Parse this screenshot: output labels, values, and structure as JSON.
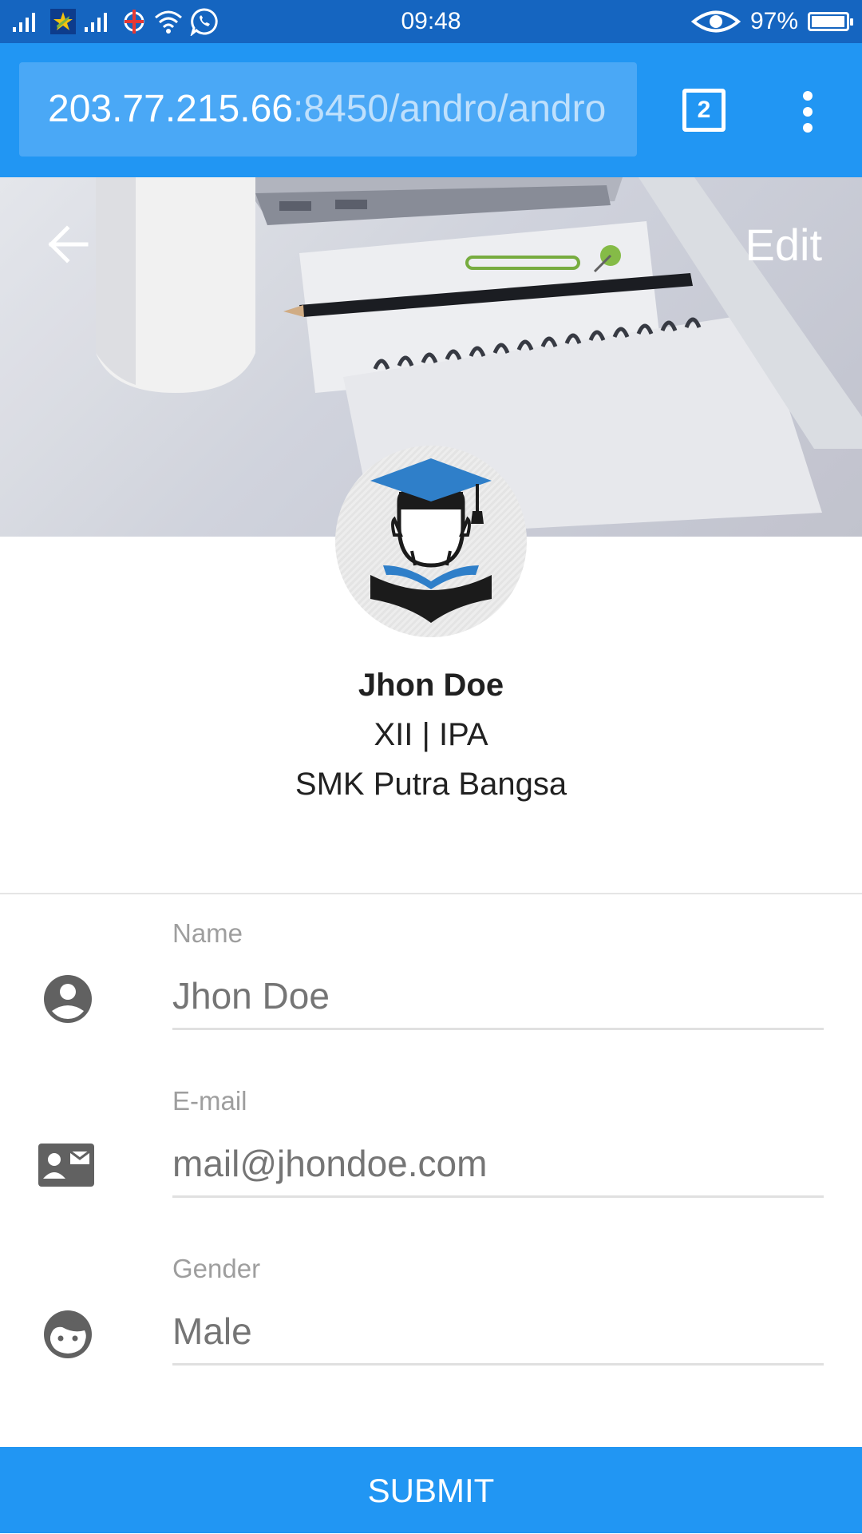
{
  "status_bar": {
    "time": "09:48",
    "battery_percent": "97%",
    "battery_level": 0.97,
    "icons": [
      "signal-icon",
      "sim-icon",
      "signal-icon",
      "location-icon",
      "wifi-icon",
      "whatsapp-icon",
      "eye-icon",
      "battery-icon"
    ]
  },
  "browser": {
    "url_host": "203.77.215.66",
    "url_path": ":8450/andro/andro",
    "tab_count": "2",
    "icons": [
      "tabs-icon",
      "more-vert-icon"
    ]
  },
  "header": {
    "back_icon": "arrow-back-icon",
    "edit_label": "Edit"
  },
  "profile": {
    "avatar_icon": "graduate-icon",
    "name": "Jhon Doe",
    "class_info": "XII | IPA",
    "school": "SMK Putra Bangsa"
  },
  "form": {
    "fields": [
      {
        "label": "Name",
        "value": "Jhon Doe",
        "icon": "account-circle-icon"
      },
      {
        "label": "E-mail",
        "value": "mail@jhondoe.com",
        "icon": "contact-mail-icon"
      },
      {
        "label": "Gender",
        "value": "Male",
        "icon": "face-icon"
      }
    ],
    "submit_label": "SUBMIT"
  },
  "colors": {
    "status_bar": "#1565c0",
    "primary": "#2196f3",
    "url_box": "#4aa8f6",
    "graduate_cap": "#2f7fc9"
  }
}
